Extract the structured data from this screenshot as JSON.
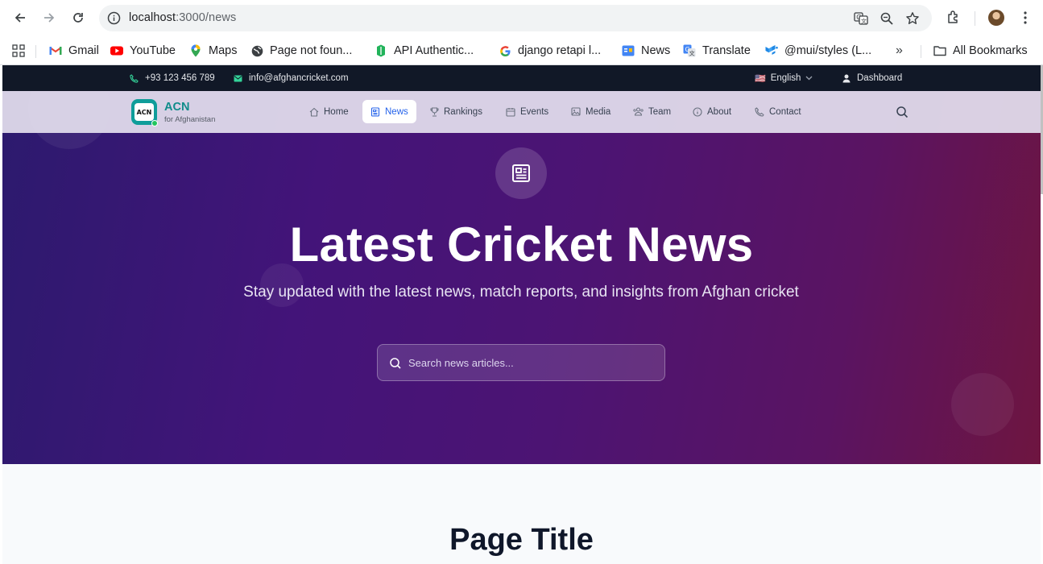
{
  "browser": {
    "url_host": "localhost",
    "url_path": ":3000/news",
    "bookmarks": [
      {
        "label": "Gmail",
        "icon": "gmail-icon"
      },
      {
        "label": "YouTube",
        "icon": "youtube-icon"
      },
      {
        "label": "Maps",
        "icon": "maps-icon"
      },
      {
        "label": "Page not foun...",
        "icon": "globe-icon"
      },
      {
        "label": "API Authentic...",
        "icon": "doc-icon"
      },
      {
        "label": "django retapi l...",
        "icon": "google-icon"
      },
      {
        "label": "News",
        "icon": "google-news-icon"
      },
      {
        "label": "Translate",
        "icon": "translate-icon"
      },
      {
        "label": "@mui/styles (L...",
        "icon": "mui-icon"
      }
    ],
    "more_bookmarks": "»",
    "all_bookmarks": "All Bookmarks"
  },
  "topbar": {
    "phone": "+93 123 456 789",
    "email": "info@afghancricket.com",
    "language": "English",
    "language_flag": "🇺🇸",
    "dashboard": "Dashboard"
  },
  "navbar": {
    "brand": "ACN",
    "brand_sub": "for Afghanistan",
    "logo_text": "ACN",
    "items": [
      {
        "label": "Home",
        "active": false
      },
      {
        "label": "News",
        "active": true
      },
      {
        "label": "Rankings",
        "active": false
      },
      {
        "label": "Events",
        "active": false
      },
      {
        "label": "Media",
        "active": false
      },
      {
        "label": "Team",
        "active": false
      },
      {
        "label": "About",
        "active": false
      },
      {
        "label": "Contact",
        "active": false
      }
    ]
  },
  "hero": {
    "title": "Latest Cricket News",
    "subtitle": "Stay updated with the latest news, match reports, and insights from Afghan cricket",
    "search_placeholder": "Search news articles..."
  },
  "main": {
    "page_title": "Page Title"
  },
  "colors": {
    "accent": "#2563eb",
    "brand": "#0f8c8a",
    "topbar_bg": "#111827"
  }
}
